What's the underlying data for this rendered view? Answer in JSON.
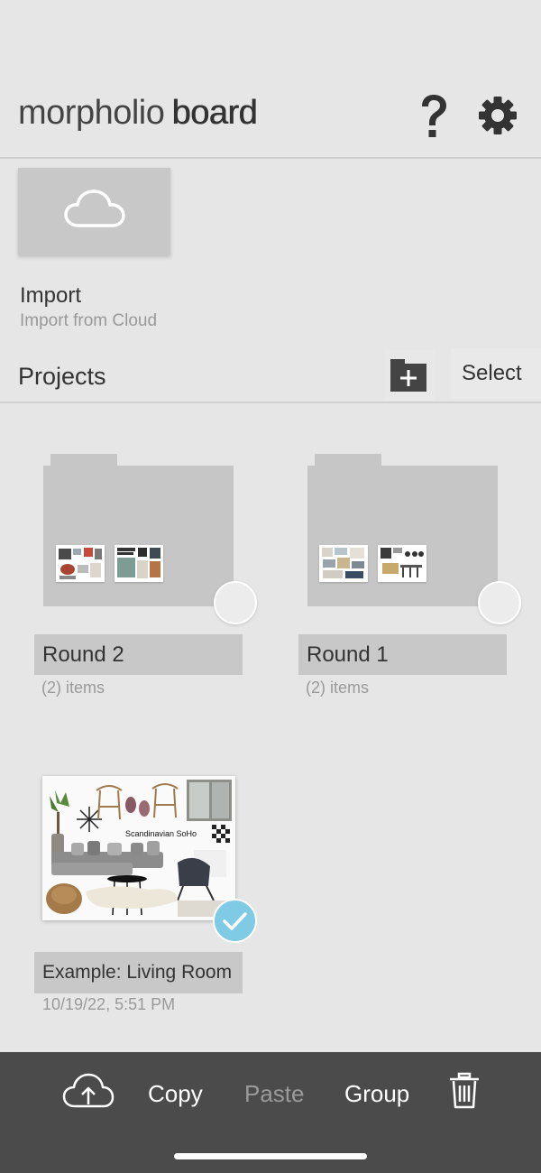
{
  "header": {
    "brand_light": "morpholio",
    "brand_bold": "board",
    "help_icon": "question-mark-icon",
    "settings_icon": "gear-icon"
  },
  "import": {
    "icon": "cloud-icon",
    "title": "Import",
    "subtitle": "Import from Cloud"
  },
  "projects": {
    "title": "Projects",
    "new_folder_icon": "new-folder-icon",
    "select_label": "Select",
    "folders": [
      {
        "name": "Round 2",
        "count": "(2) items"
      },
      {
        "name": "Round 1",
        "count": "(2) items"
      }
    ],
    "boards": [
      {
        "name": "Example: Living Room",
        "date": "10/19/22, 5:51 PM",
        "thumb_caption": "Scandinavian SoHo",
        "selected": true
      }
    ]
  },
  "toolbar": {
    "upload_icon": "cloud-upload-icon",
    "copy_label": "Copy",
    "paste_label": "Paste",
    "group_label": "Group",
    "trash_icon": "trash-icon"
  },
  "colors": {
    "background": "#e6e6e6",
    "card_gray": "#c6c6c6",
    "toolbar": "#4b4b4b",
    "check_blue": "#7fcbe6"
  }
}
